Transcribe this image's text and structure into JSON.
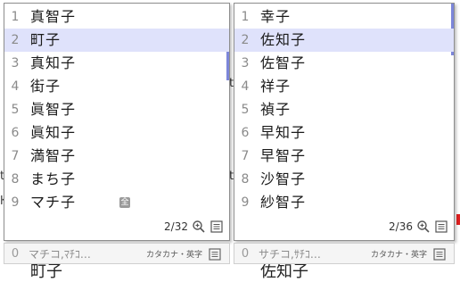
{
  "left_panel": {
    "candidates": [
      {
        "num": "1",
        "word": "真智子"
      },
      {
        "num": "2",
        "word": "町子"
      },
      {
        "num": "3",
        "word": "真知子"
      },
      {
        "num": "4",
        "word": "街子"
      },
      {
        "num": "5",
        "word": "眞智子"
      },
      {
        "num": "6",
        "word": "眞知子"
      },
      {
        "num": "7",
        "word": "満智子"
      },
      {
        "num": "8",
        "word": "まち子"
      },
      {
        "num": "9",
        "word": "マチ子"
      }
    ],
    "selected_index": 2,
    "zen_badge": "全",
    "page_count": "2/32",
    "bottom": {
      "num": "0",
      "word": "マチコ,ﾏﾁｺ…",
      "type": "カタカナ・英字"
    }
  },
  "right_panel": {
    "candidates": [
      {
        "num": "1",
        "word": "幸子"
      },
      {
        "num": "2",
        "word": "佐知子"
      },
      {
        "num": "3",
        "word": "佐智子"
      },
      {
        "num": "4",
        "word": "祥子"
      },
      {
        "num": "5",
        "word": "禎子"
      },
      {
        "num": "6",
        "word": "早知子"
      },
      {
        "num": "7",
        "word": "早智子"
      },
      {
        "num": "8",
        "word": "沙智子"
      },
      {
        "num": "9",
        "word": "紗智子"
      }
    ],
    "selected_index": 2,
    "page_count": "2/36",
    "bottom": {
      "num": "0",
      "word": "サチコ,ｻﾁｺ…",
      "type": "カタカナ・英字"
    }
  },
  "icons": {
    "zoom": "zoom-in-icon",
    "list": "list-view-icon"
  },
  "colors": {
    "selection": "#dfe2fb",
    "scrollbar": "#7c86d9"
  }
}
